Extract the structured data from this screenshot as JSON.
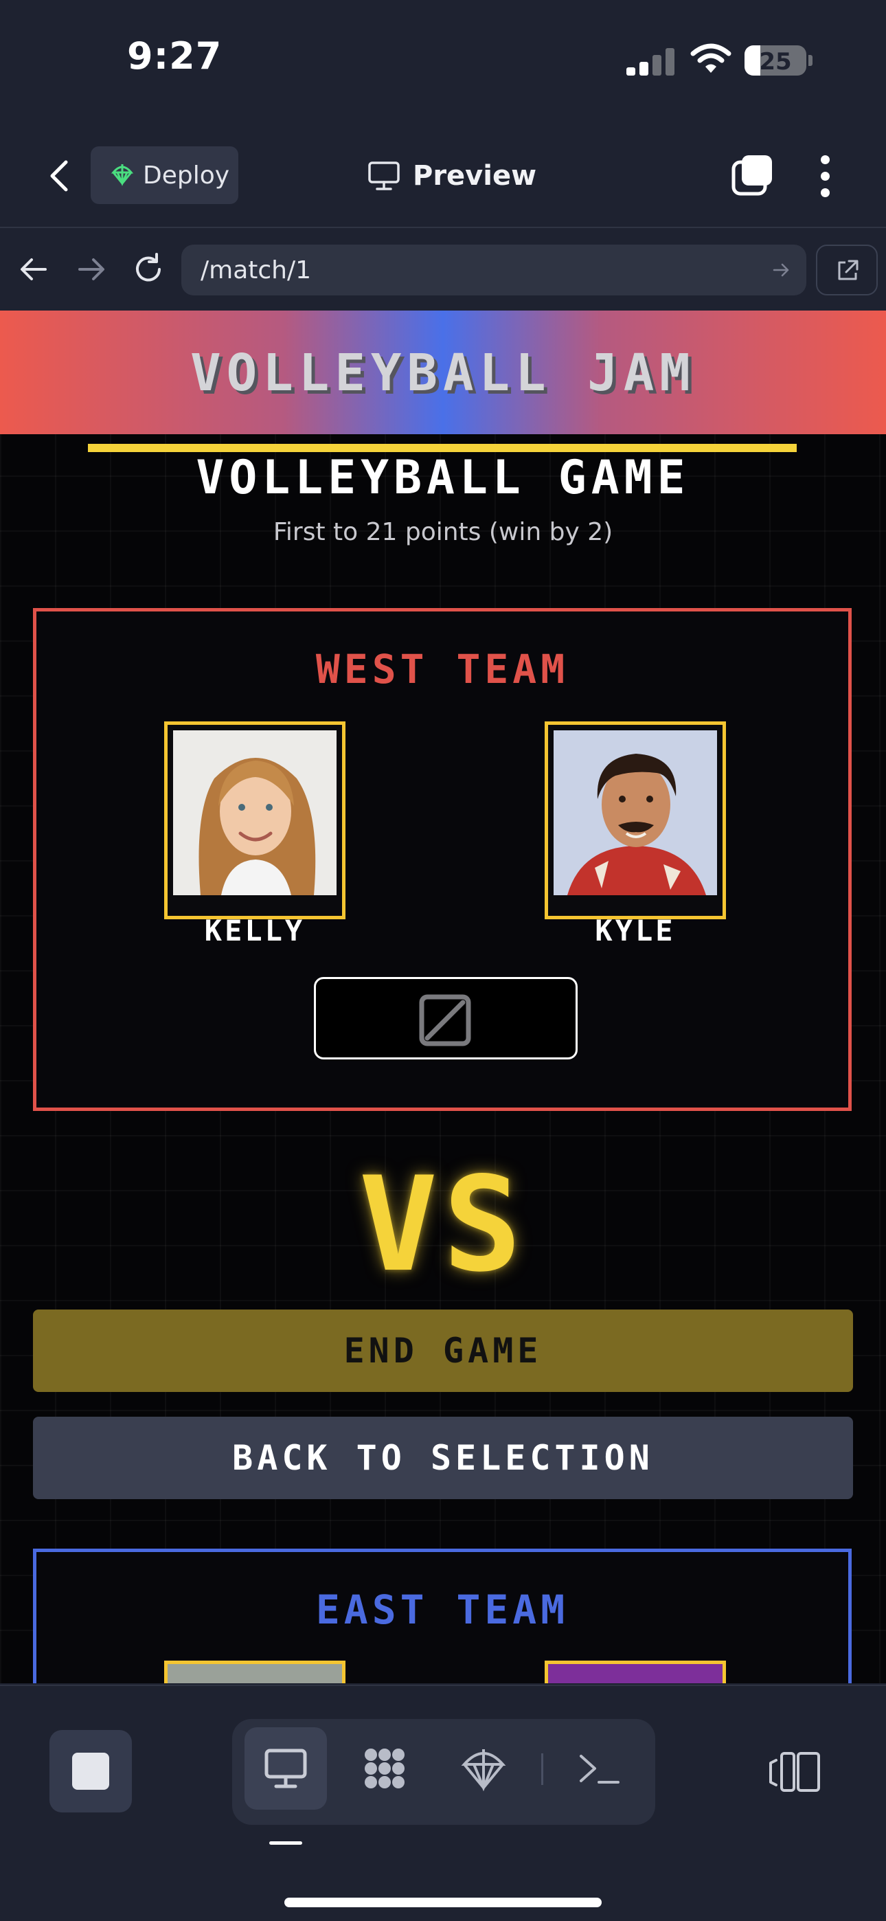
{
  "status_bar": {
    "time": "9:27",
    "battery": "25"
  },
  "app_bar": {
    "deploy_label": "Deploy",
    "preview_label": "Preview"
  },
  "browser": {
    "url": "/match/1"
  },
  "site": {
    "brand_title": "VOLLEYBALL JAM",
    "game_title": "VOLLEYBALL GAME",
    "game_subtitle": "First to 21 points (win by 2)"
  },
  "west_team": {
    "name": "WEST TEAM",
    "players": [
      {
        "name": "KELLY"
      },
      {
        "name": "KYLE"
      }
    ]
  },
  "vs_label": "VS",
  "actions": {
    "end_game": "END GAME",
    "back_to_selection": "BACK TO SELECTION"
  },
  "east_team": {
    "name": "EAST TEAM"
  },
  "colors": {
    "west": "#e0524a",
    "east": "#4a6ae0",
    "accent_yellow": "#f5d33a",
    "background": "#050507"
  },
  "toolbar": {
    "tools": [
      "desktop-icon",
      "apps-icon",
      "deploy-icon",
      "terminal-icon"
    ],
    "active_tool": "desktop-icon"
  }
}
